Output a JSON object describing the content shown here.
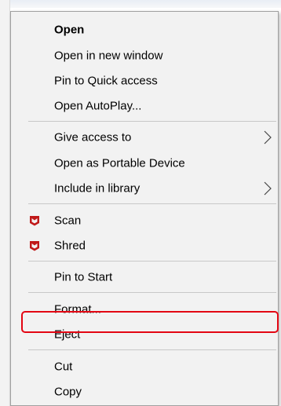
{
  "menu": {
    "items": [
      {
        "label": "Open",
        "bold": true,
        "submenu": false,
        "icon": ""
      },
      {
        "label": "Open in new window",
        "bold": false,
        "submenu": false,
        "icon": ""
      },
      {
        "label": "Pin to Quick access",
        "bold": false,
        "submenu": false,
        "icon": ""
      },
      {
        "label": "Open AutoPlay...",
        "bold": false,
        "submenu": false,
        "icon": ""
      },
      {
        "label": "Give access to",
        "bold": false,
        "submenu": true,
        "icon": ""
      },
      {
        "label": "Open as Portable Device",
        "bold": false,
        "submenu": false,
        "icon": ""
      },
      {
        "label": "Include in library",
        "bold": false,
        "submenu": true,
        "icon": ""
      },
      {
        "label": "Scan",
        "bold": false,
        "submenu": false,
        "icon": "mcafee-shield-icon"
      },
      {
        "label": "Shred",
        "bold": false,
        "submenu": false,
        "icon": "mcafee-shield-icon"
      },
      {
        "label": "Pin to Start",
        "bold": false,
        "submenu": false,
        "icon": ""
      },
      {
        "label": "Format...",
        "bold": false,
        "submenu": false,
        "icon": ""
      },
      {
        "label": "Eject",
        "bold": false,
        "submenu": false,
        "icon": "",
        "highlighted": true
      },
      {
        "label": "Cut",
        "bold": false,
        "submenu": false,
        "icon": ""
      },
      {
        "label": "Copy",
        "bold": false,
        "submenu": false,
        "icon": ""
      }
    ]
  },
  "colors": {
    "menu_background": "#f2f2f2",
    "highlight_border": "#e30613",
    "mcafee_red": "#c01818"
  }
}
